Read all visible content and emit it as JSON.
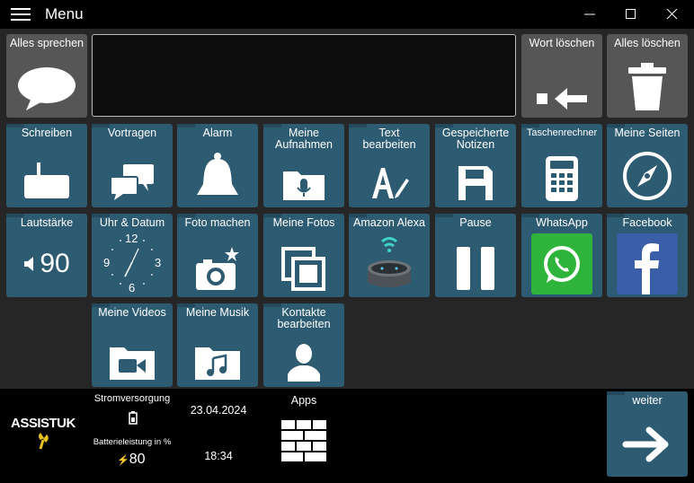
{
  "window": {
    "title": "Menu",
    "icons": [
      "menu-icon",
      "minimize-icon",
      "maximize-icon",
      "close-icon"
    ]
  },
  "top": {
    "speak_all": "Alles sprechen",
    "delete_word": "Wort löschen",
    "delete_all": "Alles löschen",
    "text_value": ""
  },
  "tiles": {
    "write": "Schreiben",
    "present": "Vortragen",
    "alarm": "Alarm",
    "recordings_1": "Meine",
    "recordings_2": "Aufnahmen",
    "edit_text_1": "Text",
    "edit_text_2": "bearbeiten",
    "notes_1": "Gespeicherte",
    "notes_2": "Notizen",
    "calculator": "Taschenrechner",
    "pages": "Meine Seiten",
    "volume": "Lautstärke",
    "volume_value": "90",
    "clock": "Uhr & Datum",
    "clock_12": "12",
    "clock_3": "3",
    "clock_6": "6",
    "clock_9": "9",
    "photo": "Foto machen",
    "photos": "Meine Fotos",
    "alexa": "Amazon Alexa",
    "pause": "Pause",
    "whatsapp": "WhatsApp",
    "facebook": "Facebook",
    "videos": "Meine Videos",
    "music": "Meine Musik",
    "contacts_1": "Kontakte",
    "contacts_2": "bearbeiten"
  },
  "footer": {
    "logo_text": "ASSISTUK",
    "power_label": "Stromversorgung",
    "battery_label": "Batterieleistung in %",
    "battery_value": "80",
    "date": "23.04.2024",
    "time": "18:34",
    "apps_label": "Apps",
    "next_label": "weiter"
  },
  "colors": {
    "tile": "#2d5b71",
    "tile_gray": "#565656",
    "whatsapp": "#2fb43b",
    "facebook": "#3b5ea8"
  }
}
